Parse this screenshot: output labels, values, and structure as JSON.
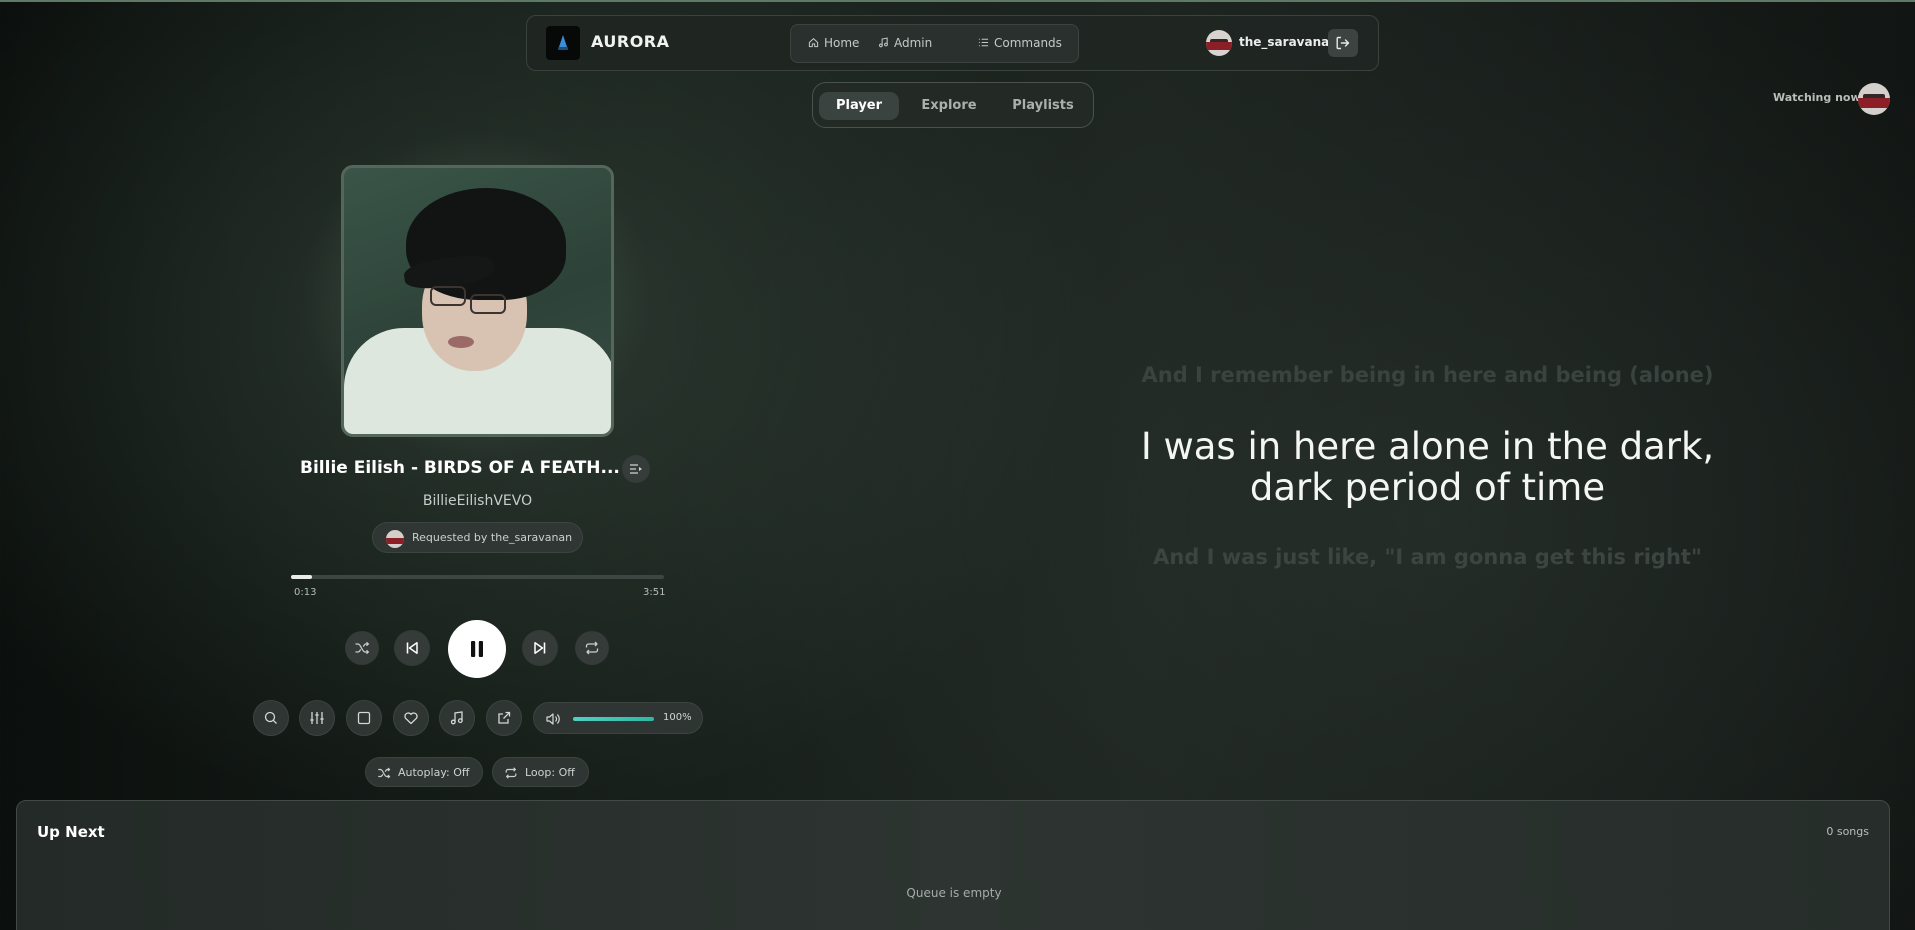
{
  "app": {
    "name": "AURORA"
  },
  "nav": {
    "links": [
      {
        "label": "Home",
        "icon": "home-icon"
      },
      {
        "label": "Admin",
        "icon": "music-note-icon"
      },
      {
        "label": "Commands",
        "icon": "list-icon"
      }
    ],
    "user": {
      "name": "the_saravanan"
    }
  },
  "tabs": [
    {
      "label": "Player",
      "active": true
    },
    {
      "label": "Explore",
      "active": false
    },
    {
      "label": "Playlists",
      "active": false
    }
  ],
  "watching": {
    "label": "Watching now:"
  },
  "track": {
    "title": "Billie Eilish - BIRDS OF A FEATH...",
    "artist": "BillieEilishVEVO",
    "requested_by": "Requested by the_saravanan",
    "current_time": "0:13",
    "total_time": "3:51",
    "progress": 0.056
  },
  "volume": {
    "level": 1.0,
    "label": "100%"
  },
  "toggles": {
    "autoplay": "Autoplay: Off",
    "loop": "Loop: Off"
  },
  "lyrics": {
    "previous": "And I remember being in here and being (alone)",
    "current_line1": "I was in here alone in the dark,",
    "current_line2": "dark period of time",
    "next": "And I was just like, \"I am gonna get this right\""
  },
  "queue": {
    "title": "Up Next",
    "count": "0 songs",
    "empty_message": "Queue is empty"
  },
  "colors": {
    "accent": "#4fd1c5",
    "background": "#1a201d",
    "panel": "#2e3532"
  }
}
